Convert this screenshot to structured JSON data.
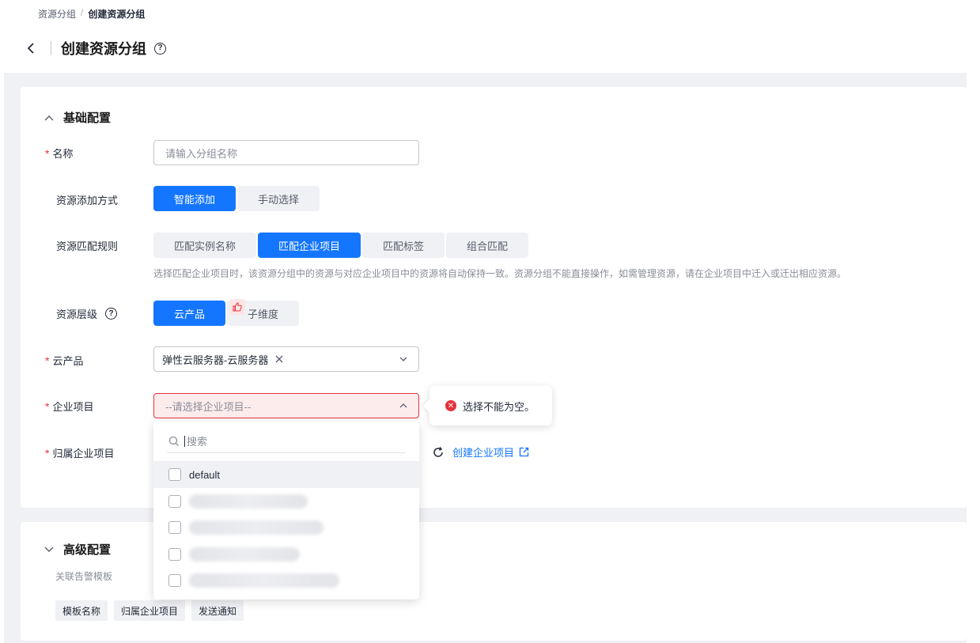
{
  "breadcrumb": {
    "parent": "资源分组",
    "separator": "/",
    "current": "创建资源分组"
  },
  "page": {
    "title": "创建资源分组",
    "help": "?"
  },
  "basic": {
    "title": "基础配置",
    "name": {
      "label": "名称",
      "placeholder": "请输入分组名称"
    },
    "add_method": {
      "label": "资源添加方式",
      "options": [
        "智能添加",
        "手动选择"
      ],
      "selected": "智能添加"
    },
    "match_rule": {
      "label": "资源匹配规则",
      "options": [
        "匹配实例名称",
        "匹配企业项目",
        "匹配标签",
        "组合匹配"
      ],
      "selected": "匹配企业项目",
      "hint": "选择匹配企业项目时，该资源分组中的资源与对应企业项目中的资源将自动保持一致。资源分组不能直接操作，如需管理资源，请在企业项目中迁入或迁出相应资源。"
    },
    "level": {
      "label": "资源层级",
      "help": "?",
      "options": [
        "云产品",
        "子维度"
      ],
      "selected": "云产品"
    },
    "cloud_product": {
      "label": "云产品",
      "tag": "弹性云服务器-云服务器"
    },
    "enterprise_project": {
      "label": "企业项目",
      "placeholder": "--请选择企业项目--",
      "error": "选择不能为空。"
    },
    "owner_project": {
      "label": "归属企业项目",
      "create_link": "创建企业项目"
    }
  },
  "dropdown": {
    "search_placeholder": "搜索",
    "items": [
      {
        "label": "default",
        "hover": true
      }
    ]
  },
  "advanced": {
    "title": "高级配置",
    "sub_label": "关联告警模板",
    "columns": [
      "模板名称",
      "归属企业项目",
      "发送通知"
    ]
  },
  "colors": {
    "primary": "#1476ff",
    "error": "#e6323c",
    "background": "#f0f1f4"
  }
}
